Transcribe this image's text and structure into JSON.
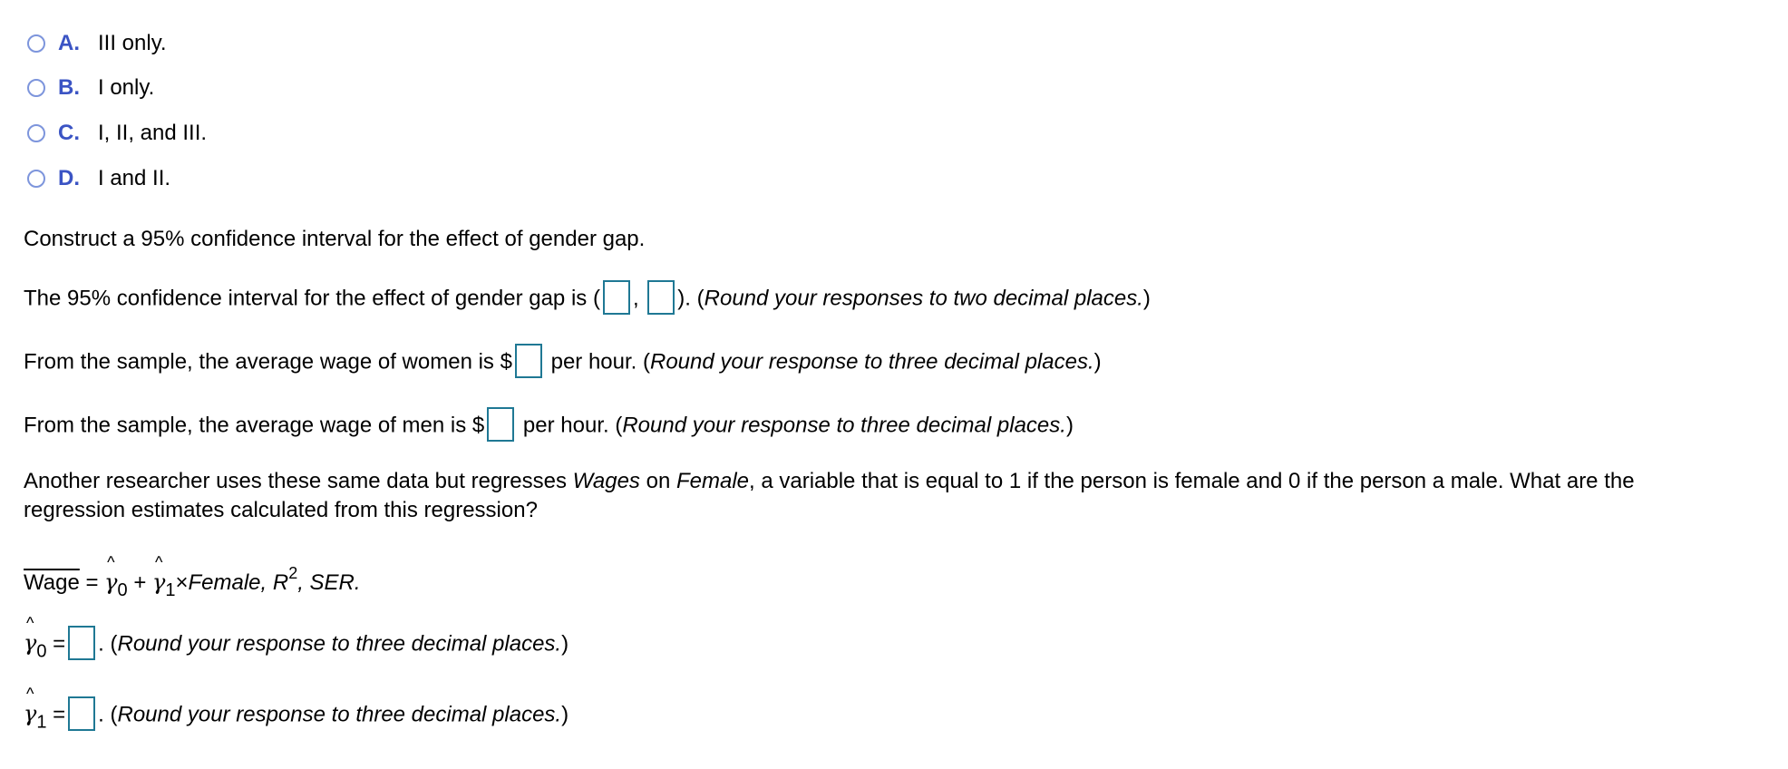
{
  "options": [
    {
      "letter": "A.",
      "text": "III only."
    },
    {
      "letter": "B.",
      "text": "I only."
    },
    {
      "letter": "C.",
      "text": "I, II, and III."
    },
    {
      "letter": "D.",
      "text": "I and II."
    }
  ],
  "colors": {
    "option_letter": "#3b54c4",
    "radio_border": "#7d95dc",
    "input_border": "#1f7894"
  },
  "ci_prompt": "Construct a 95% confidence interval for the effect of gender gap.",
  "ci_line": {
    "prefix": "The 95% confidence interval for the effect of gender gap is (",
    "sep": ",",
    "close": ").",
    "note_open": " (",
    "note": "Round your responses to two decimal places.",
    "note_close": ")"
  },
  "women_line": {
    "prefix": "From the sample, the average wage of women is $",
    "suffix": " per hour. (",
    "note": "Round your response to three decimal places.",
    "note_close": ")"
  },
  "men_line": {
    "prefix": "From the sample, the average wage of men is $",
    "suffix": " per hour. (",
    "note": "Round your response to three decimal places.",
    "note_close": ")"
  },
  "regression_text": {
    "part1": "Another researcher uses these same data but regresses ",
    "wages": "Wages",
    "part2": " on ",
    "female": "Female",
    "part3": ", a variable that is equal to 1 if the person is female and 0 if the person a male. What are the",
    "line2": "regression estimates calculated from this regression?"
  },
  "equation": {
    "lhs": "Wage",
    "eq": " = ",
    "gamma": "γ",
    "hat": "^",
    "sub0": "0",
    "plus": " + ",
    "sub1": "1",
    "times": "×",
    "female": "Female, R",
    "sup2": "2",
    "ser": ", SER."
  },
  "gamma0_line": {
    "eq": " =",
    "note_open": ". (",
    "note": "Round your response to three decimal places.",
    "note_close": ")"
  },
  "gamma1_line": {
    "eq": " =",
    "note_open": ". (",
    "note": "Round your response to three decimal places.",
    "note_close": ")"
  }
}
